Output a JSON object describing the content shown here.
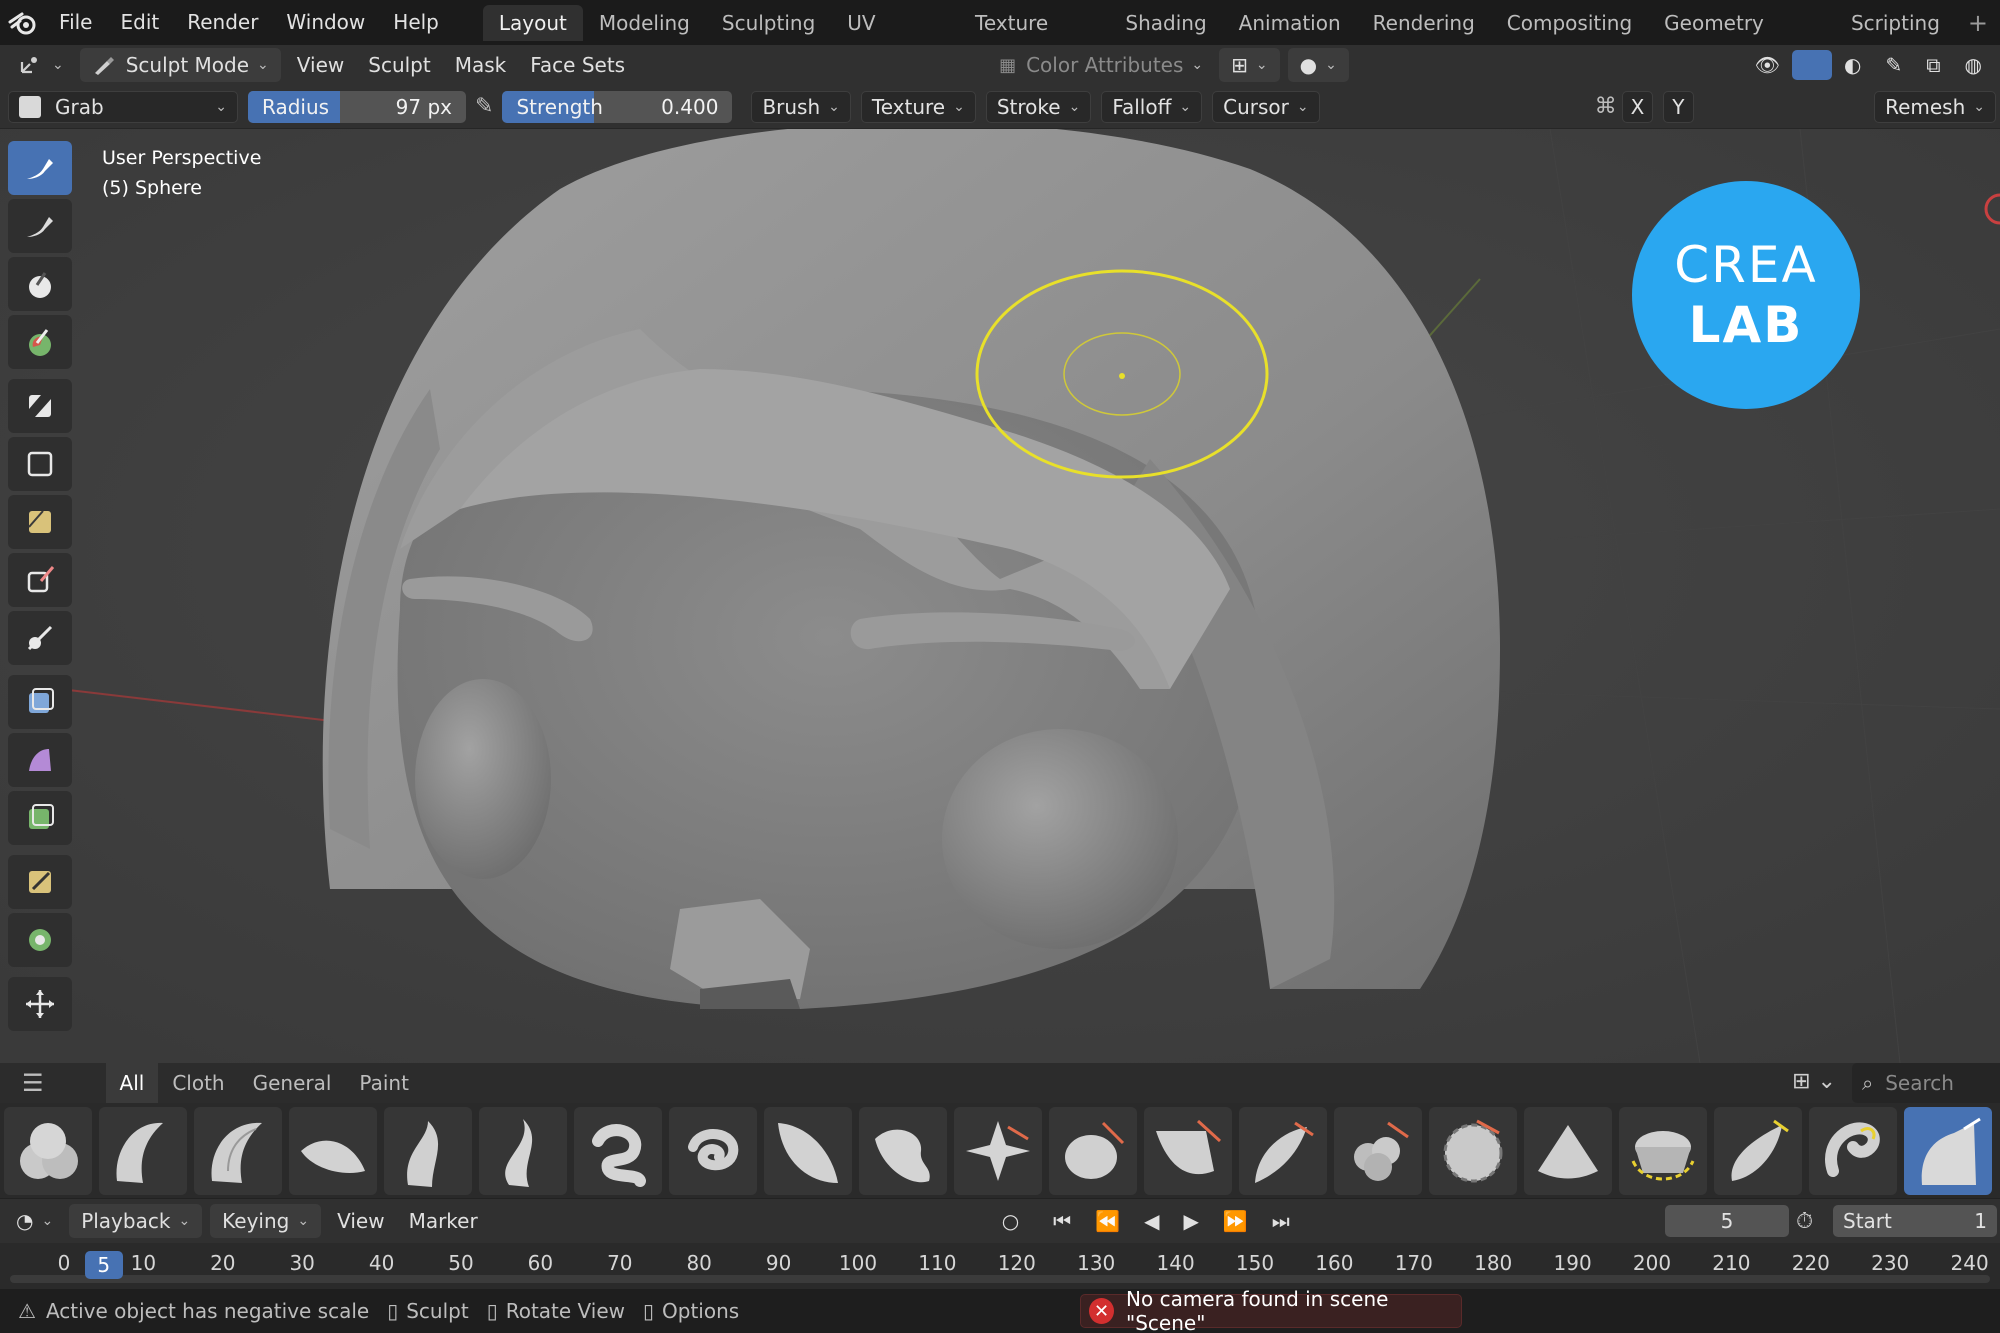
{
  "menubar": {
    "items": [
      "File",
      "Edit",
      "Render",
      "Window",
      "Help"
    ],
    "workspaces": [
      "Layout",
      "Modeling",
      "Sculpting",
      "UV Editing",
      "Texture Paint",
      "Shading",
      "Animation",
      "Rendering",
      "Compositing",
      "Geometry Nodes",
      "Scripting"
    ],
    "active_workspace": "Layout",
    "add_label": "+"
  },
  "header": {
    "mode": "Sculpt Mode",
    "menus": [
      "View",
      "Sculpt",
      "Mask",
      "Face Sets"
    ],
    "color_attributes": "Color Attributes"
  },
  "toolsettings": {
    "brush_name": "Grab",
    "radius_label": "Radius",
    "radius_value": "97 px",
    "radius_fill": 0.42,
    "strength_label": "Strength",
    "strength_value": "0.400",
    "strength_fill": 0.4,
    "menus": [
      "Brush",
      "Texture",
      "Stroke",
      "Falloff",
      "Cursor"
    ],
    "axis_x": "X",
    "axis_y": "Y",
    "remesh_label": "Remesh"
  },
  "viewport": {
    "view_name": "User Perspective",
    "object_name": "(5) Sphere",
    "badge_line1": "CREA",
    "badge_line2": "LAB"
  },
  "shelf": {
    "tabs": [
      "All",
      "Cloth",
      "General",
      "Paint"
    ],
    "active_tab": "All",
    "search_placeholder": "Search"
  },
  "timeline": {
    "menus": [
      "Playback",
      "Keying",
      "View",
      "Marker"
    ],
    "current_frame": "5",
    "start_label": "Start",
    "start_value": "1",
    "frame_labels": [
      "0",
      "10",
      "20",
      "30",
      "40",
      "50",
      "60",
      "70",
      "80",
      "90",
      "100",
      "110",
      "120",
      "130",
      "140",
      "150",
      "160",
      "170",
      "180",
      "190",
      "200",
      "210",
      "220",
      "230",
      "240"
    ]
  },
  "statusbar": {
    "warning": "Active object has negative scale",
    "hint_sculpt": "Sculpt",
    "hint_rotate": "Rotate View",
    "hint_options": "Options",
    "error": "No camera found in scene \"Scene\""
  },
  "colors": {
    "accent": "#4772b3",
    "brush_cursor": "#e8e02a",
    "badge": "#2aa7f0",
    "error": "#d32f2f"
  }
}
